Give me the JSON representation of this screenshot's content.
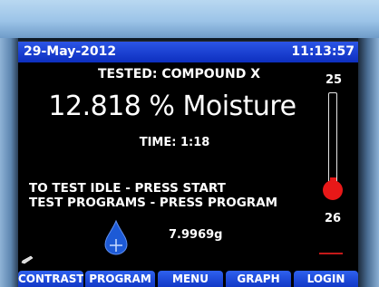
{
  "header": {
    "date": "29-May-2012",
    "time": "11:13:57"
  },
  "status": {
    "tested": "TESTED: COMPOUND X",
    "result": "12.818 % Moisture",
    "elapsed": "TIME: 1:18",
    "instruction_1": "TO TEST IDLE - PRESS START",
    "instruction_2": "TEST PROGRAMS - PRESS PROGRAM",
    "sample_weight": "7.9969g"
  },
  "thermometer": {
    "top_label": "25",
    "bottom_label": "26",
    "fill_fraction": 0.08,
    "color": "#e81818"
  },
  "icons": {
    "sample": "water-drop-icon",
    "edit": "pencil-icon"
  },
  "buttons": {
    "contrast": "CONTRAST",
    "program": "PROGRAM",
    "menu": "MENU",
    "graph": "GRAPH",
    "login": "LOGIN"
  },
  "colors": {
    "title_bar": "#1a3fd6",
    "button": "#1f4fe0",
    "thermometer": "#e81818",
    "drop": "#1d5ad6"
  }
}
